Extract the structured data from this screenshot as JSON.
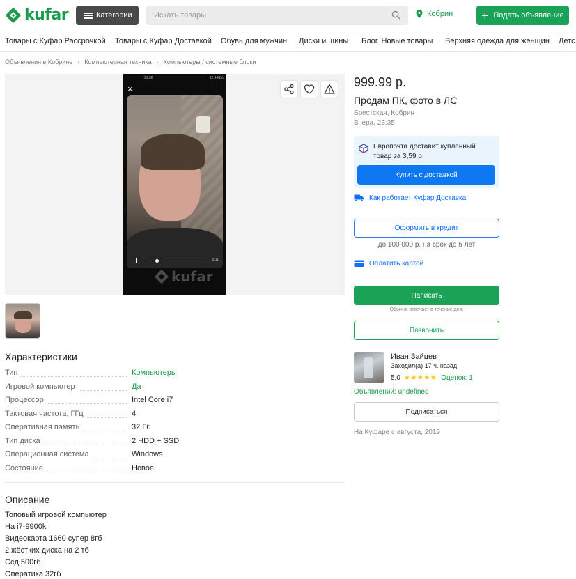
{
  "header": {
    "logo_text": "kufar",
    "categories_label": "Категории",
    "search_placeholder": "Искать товары",
    "location": "Кобрин",
    "post_ad_label": "Подать объявление"
  },
  "category_strip": [
    "Товары с Куфар Рассрочкой",
    "Товары с Куфар Доставкой",
    "Обувь для мужчин",
    "Диски и шины",
    "Блог. Новые товары",
    "Верхняя одежда для женщин",
    "Детс"
  ],
  "breadcrumb": [
    "Объявления в Кобрине",
    "Компьютерная техника",
    "Компьютеры / системные блоки"
  ],
  "gallery": {
    "status_left": "21:36",
    "status_right": "12,4 КБ/с",
    "video_time": "0:11",
    "video_progress": 0.22,
    "watermark": "kufar"
  },
  "characteristics": {
    "title": "Характеристики",
    "rows": [
      {
        "name": "Тип",
        "value": "Компьютеры",
        "link": true
      },
      {
        "name": "Игровой компьютер",
        "value": "Да",
        "link": true
      },
      {
        "name": "Процессор",
        "value": "Intel Core i7",
        "link": false
      },
      {
        "name": "Тактовая частота, ГГц",
        "value": "4",
        "link": false
      },
      {
        "name": "Оперативная память",
        "value": "32 Гб",
        "link": false
      },
      {
        "name": "Тип диска",
        "value": "2 HDD + SSD",
        "link": false
      },
      {
        "name": "Операционная система",
        "value": "Windows",
        "link": false
      },
      {
        "name": "Состояние",
        "value": "Новое",
        "link": false
      }
    ]
  },
  "description": {
    "title": "Описание",
    "lines": [
      "Топовый игровой компьютер",
      "На i7-9900k",
      "Видеокарта 1660 супер 8гб",
      "2 жёстких диска на 2 тб",
      "Ссд 500гб",
      "Оператика 32гб"
    ]
  },
  "listing": {
    "price": "999.99 р.",
    "title": "Продам ПК, фото в ЛС",
    "region": "Брестская, Кобрин",
    "posted": "Вчера, 23:35",
    "europost_text": "Европочта доставит купленный товар за 3,59 р.",
    "buy_delivery_label": "Купить с доставкой",
    "how_delivery_label": "Как работает Куфар Доставка",
    "credit_label": "Оформить в кредит",
    "credit_note": "до 100 000 р. на срок до 5 лет",
    "pay_card_label": "Оплатить картой",
    "write_label": "Написать",
    "reply_note": "Обычно отвечает в течение дня.",
    "call_label": "Позвонить"
  },
  "seller": {
    "name": "Иван Зайцев",
    "last_seen": "Заходил(а) 17 ч. назад",
    "rating": "5,0",
    "stars": 5,
    "reviews_label": "Оценок: 1",
    "ads_label": "Объявлений: undefined",
    "subscribe_label": "Подписаться",
    "since": "На Куфаре с августа, 2019"
  },
  "colors": {
    "brand_green": "#1aa357",
    "blue": "#0d78f2",
    "dark_button": "#494949"
  }
}
